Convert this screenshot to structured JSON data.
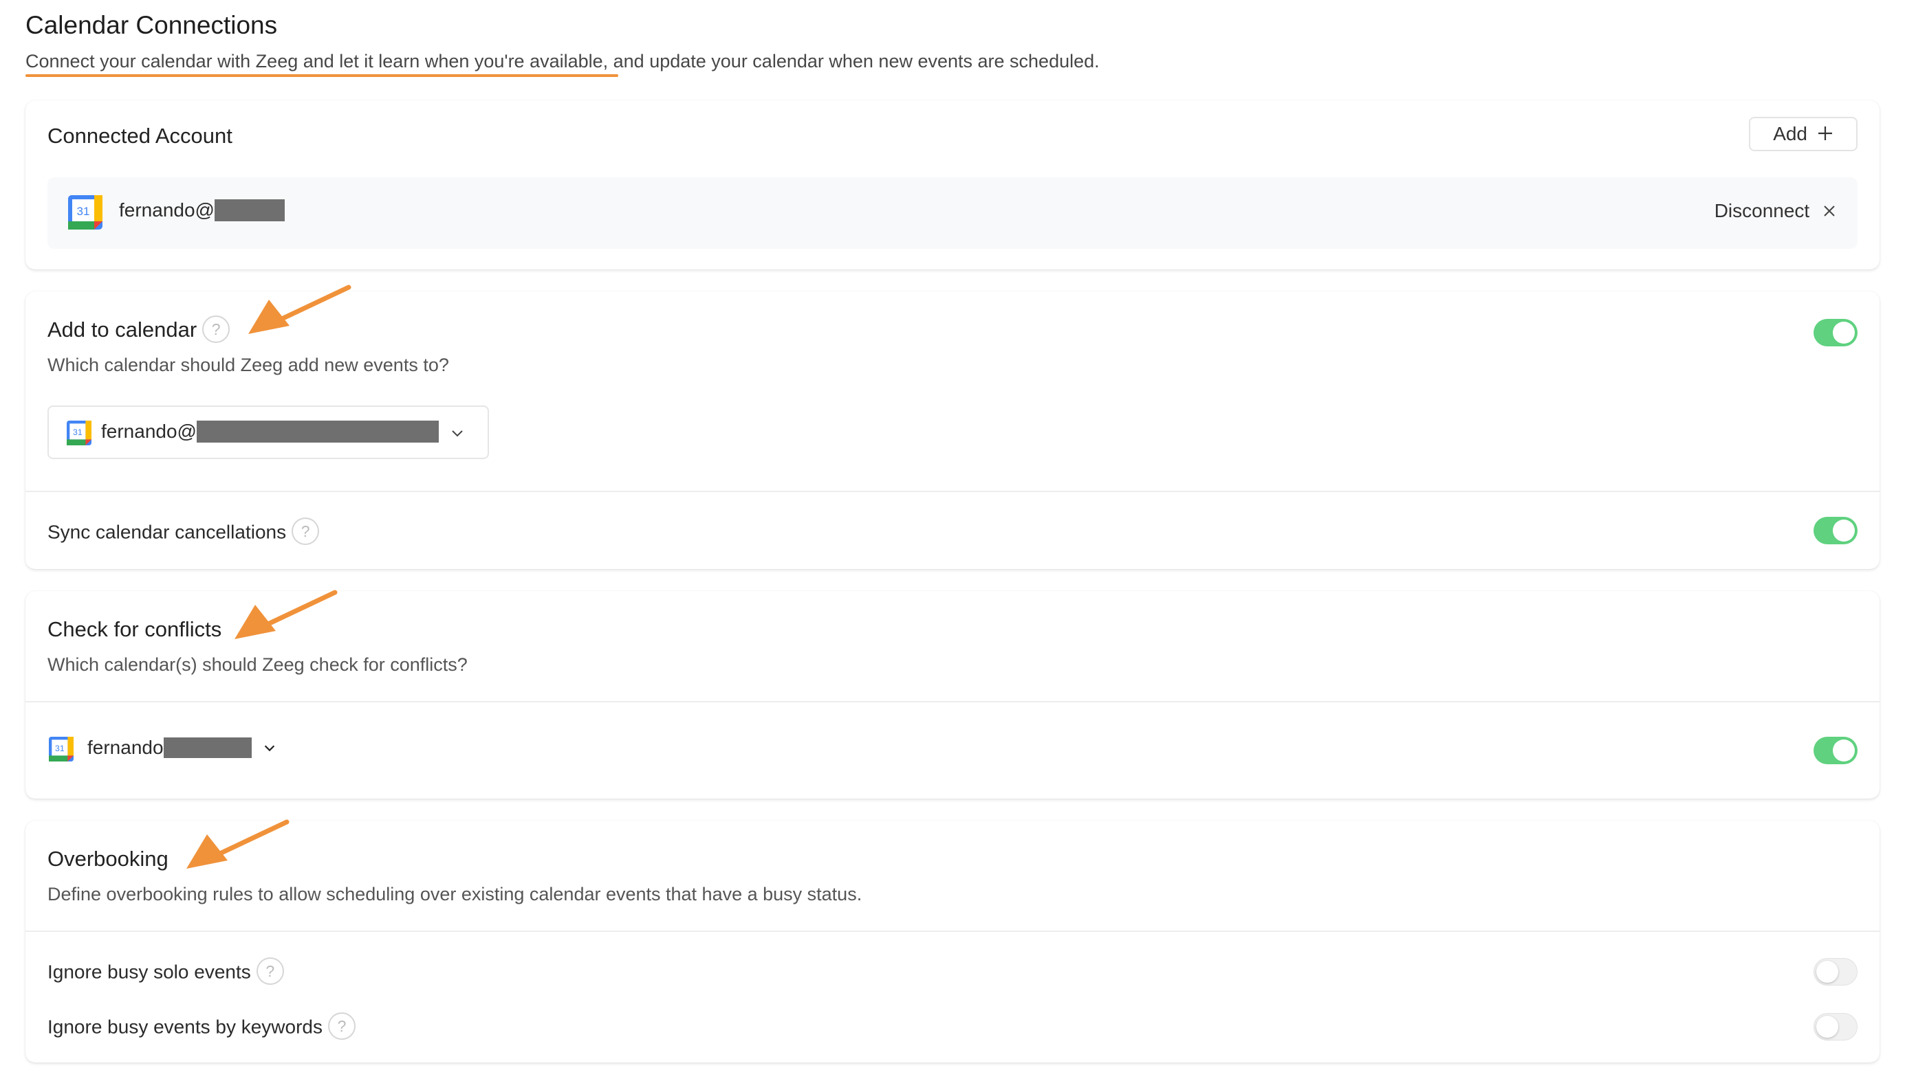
{
  "header": {
    "title": "Calendar Connections",
    "subtitle": "Connect your calendar with Zeeg and let it learn when you're available, and update your calendar when new events are scheduled."
  },
  "connected_account": {
    "title": "Connected Account",
    "add_label": "Add",
    "account_email_prefix": "fernando@",
    "disconnect_label": "Disconnect"
  },
  "add_to_calendar": {
    "title": "Add to calendar",
    "description": "Which calendar should Zeeg add new events to?",
    "selected_calendar_prefix": "fernando@",
    "help_glyph": "?",
    "enabled": true,
    "sync_label": "Sync calendar cancellations",
    "sync_enabled": true
  },
  "check_conflicts": {
    "title": "Check for conflicts",
    "description": "Which calendar(s) should Zeeg check for conflicts?",
    "calendar_prefix": "fernando",
    "enabled": true
  },
  "overbooking": {
    "title": "Overbooking",
    "description": "Define overbooking rules to allow scheduling over existing calendar events that have a busy status.",
    "ignore_solo_label": "Ignore busy solo events",
    "ignore_solo_enabled": false,
    "ignore_keywords_label": "Ignore busy events by keywords",
    "ignore_keywords_enabled": false
  },
  "calendar_icon_text": "31",
  "colors": {
    "accent_annotation": "#f0923a",
    "toggle_on": "#5fd17f",
    "toggle_off": "#f1f1f1"
  }
}
